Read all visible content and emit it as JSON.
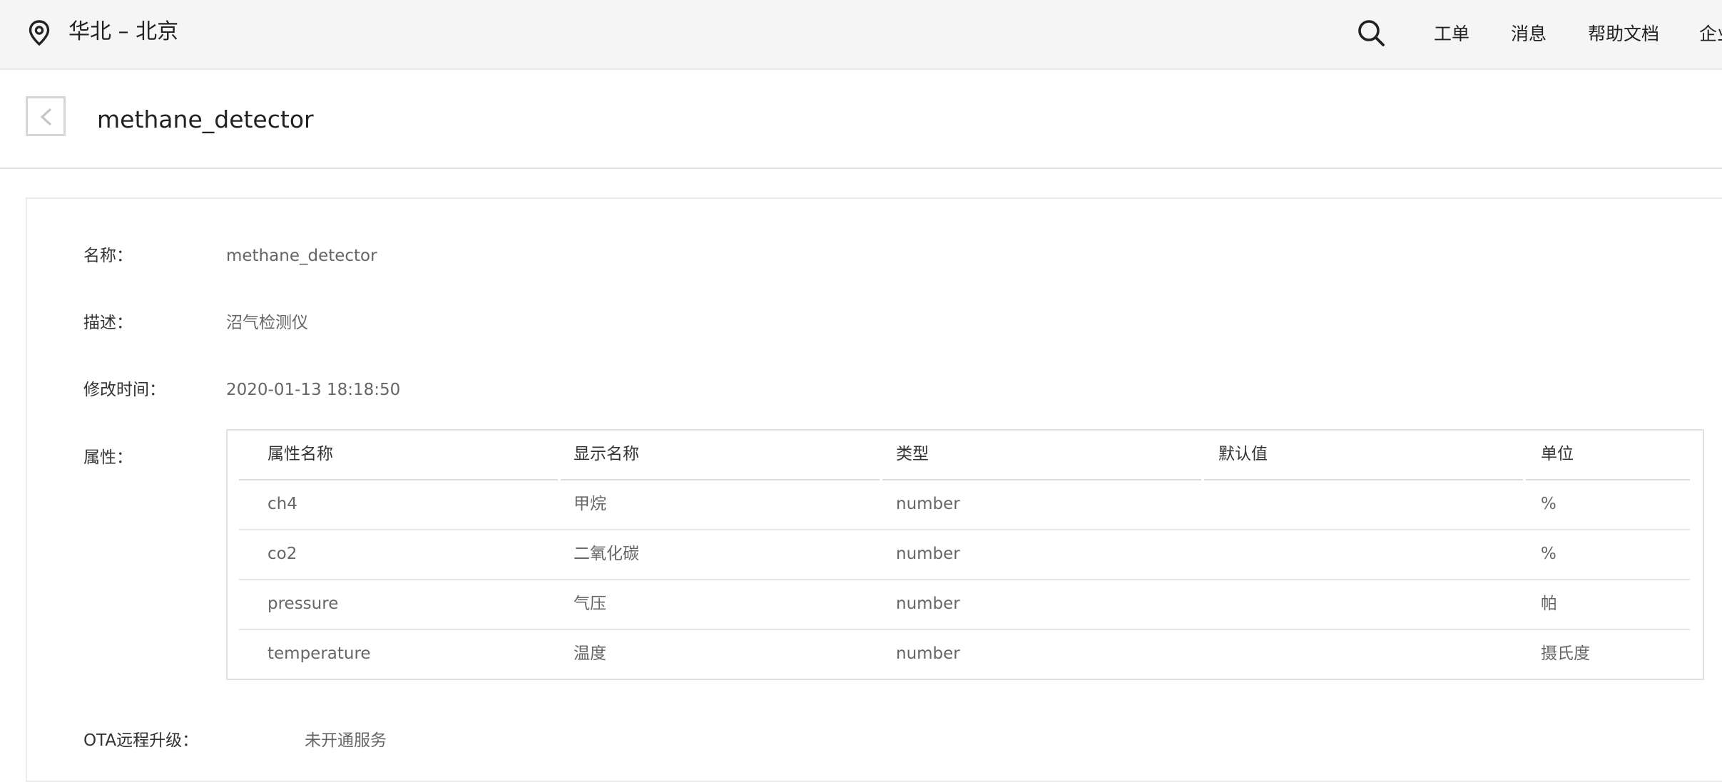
{
  "topbar": {
    "region": "华北 – 北京",
    "nav": [
      "工单",
      "消息",
      "帮助文档",
      "企业"
    ],
    "icons": [
      "location-pin-icon",
      "search-icon"
    ]
  },
  "header": {
    "back_icon": "chevron-left-icon",
    "title": "methane_detector"
  },
  "details": {
    "name_label": "名称：",
    "name_value": "methane_detector",
    "desc_label": "描述：",
    "desc_value": "沼气检测仪",
    "modified_label": "修改时间：",
    "modified_value": "2020-01-13 18:18:50",
    "props_label": "属性：",
    "ota_label": "OTA远程升级：",
    "ota_value": "未开通服务"
  },
  "table": {
    "columns": [
      "属性名称",
      "显示名称",
      "类型",
      "默认值",
      "单位"
    ],
    "rows": [
      {
        "name": "ch4",
        "display": "甲烷",
        "type": "number",
        "default": "",
        "unit": "%"
      },
      {
        "name": "co2",
        "display": "二氧化碳",
        "type": "number",
        "default": "",
        "unit": "%"
      },
      {
        "name": "pressure",
        "display": "气压",
        "type": "number",
        "default": "",
        "unit": "帕"
      },
      {
        "name": "temperature",
        "display": "温度",
        "type": "number",
        "default": "",
        "unit": "摄氏度"
      }
    ]
  },
  "colors": {
    "topbar_bg": "#f5f5f5",
    "text_primary": "#333333",
    "text_secondary": "#666666",
    "border": "#e0e0e0"
  }
}
